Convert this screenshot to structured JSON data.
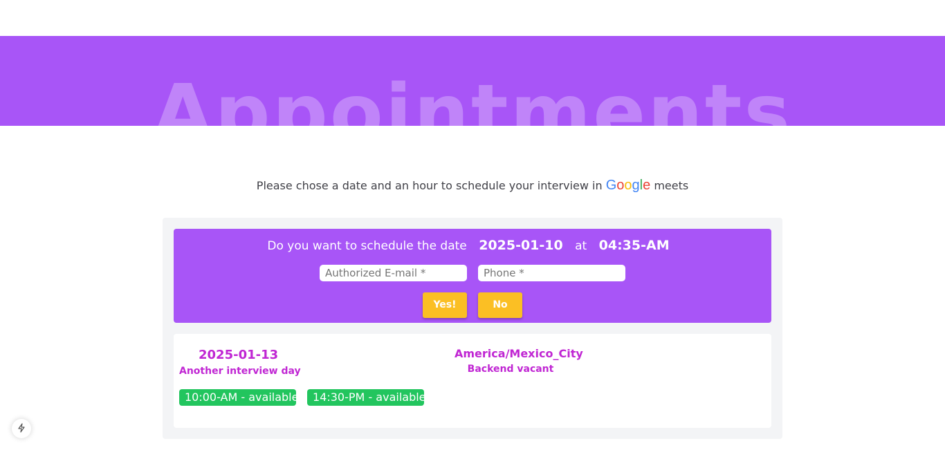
{
  "hero": {
    "title": "Appointments"
  },
  "intro": {
    "before": "Please chose a date and an hour to schedule your interview in",
    "google": [
      "G",
      "o",
      "o",
      "g",
      "l",
      "e"
    ],
    "after": "meets"
  },
  "confirm": {
    "question": "Do you want to schedule the date",
    "date": "2025-01-10",
    "at": "at",
    "time": "04:35-AM",
    "email_placeholder": "Authorized E-mail *",
    "phone_placeholder": "Phone *",
    "yes_label": "Yes!",
    "no_label": "No"
  },
  "day": {
    "date": "2025-01-13",
    "description": "Another interview day",
    "timezone": "America/Mexico_City",
    "vacancy": "Backend vacant",
    "slots": [
      {
        "time": "10:00-AM",
        "status": "- available"
      },
      {
        "time": "14:30-PM",
        "status": "- available"
      }
    ]
  },
  "colors": {
    "brand": "#a855f7",
    "accent_text": "#c026d3",
    "available": "#22c55e",
    "button": "#fbbf24"
  },
  "icons": {
    "fab": "bolt-icon"
  }
}
